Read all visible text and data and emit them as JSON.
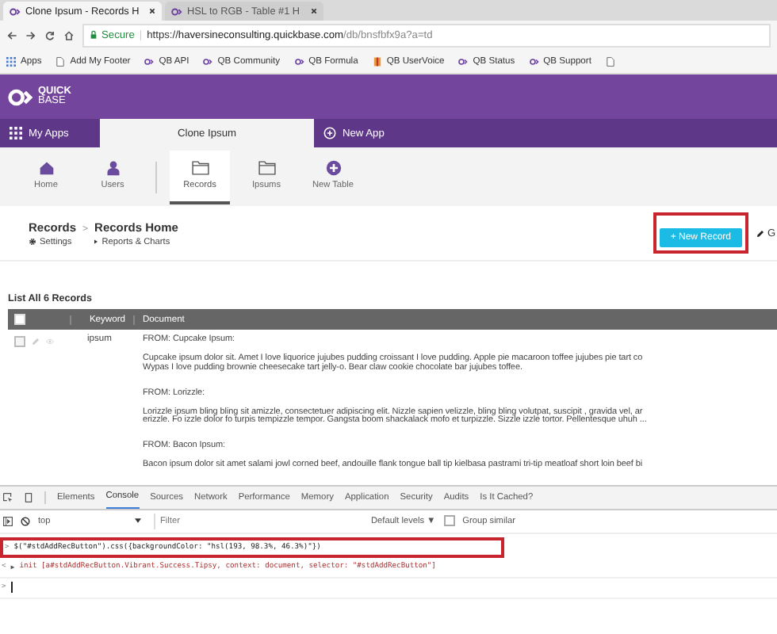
{
  "browser_tabs": [
    {
      "title": "Clone Ipsum - Records H",
      "selected": true
    },
    {
      "title": "HSL to RGB - Table #1 H",
      "selected": false
    }
  ],
  "address_bar": {
    "secure_label": "Secure",
    "divider": "|",
    "url_scheme": "https://",
    "url_host": "haversineconsulting.quickbase.com",
    "url_path": "/db/bnsfbfx9a?a=td"
  },
  "bookmarks": [
    {
      "label": "Apps",
      "kind": "apps"
    },
    {
      "label": "Add My Footer",
      "kind": "page"
    },
    {
      "label": "QB API",
      "kind": "qb"
    },
    {
      "label": "QB Community",
      "kind": "qb"
    },
    {
      "label": "QB Formula",
      "kind": "qb"
    },
    {
      "label": "QB UserVoice",
      "kind": "voice"
    },
    {
      "label": "QB Status",
      "kind": "qb"
    },
    {
      "label": "QB Support",
      "kind": "qb"
    }
  ],
  "logo": {
    "line_1": "QUICK",
    "line_2": "BASE"
  },
  "app_tabs": [
    {
      "label": "My Apps",
      "kind": "apps",
      "selected": false
    },
    {
      "label": "Clone Ipsum",
      "kind": "plain",
      "selected": true
    },
    {
      "label": "New App",
      "kind": "new",
      "selected": false
    }
  ],
  "table_tabs": [
    {
      "label": "Home",
      "kind": "home",
      "selected": false
    },
    {
      "label": "Users",
      "kind": "user",
      "selected": false
    },
    {
      "label": "Records",
      "kind": "folder",
      "selected": true
    },
    {
      "label": "Ipsums",
      "kind": "folder",
      "selected": false
    },
    {
      "label": "New Table",
      "kind": "add",
      "selected": false
    }
  ],
  "breadcrumb": {
    "table": "Records",
    "separator": ">",
    "page": "Records Home",
    "settings": "Settings",
    "reports": "Reports & Charts"
  },
  "new_record_button": "+ New Record",
  "edit_link": "G",
  "report_title": "List All 6 Records",
  "table": {
    "select_all_checked": false,
    "columns": [
      "Keyword",
      "Document"
    ],
    "rows": [
      {
        "checked": false,
        "keyword": "ipsum",
        "blocks": [
          {
            "heading": "FROM: Cupcake Ipsum:",
            "lines": [
              "Cupcake ipsum dolor sit. Amet I love liquorice jujubes pudding croissant I love pudding. Apple pie macaroon toffee jujubes pie tart co",
              "Wypas I love pudding brownie cheesecake tart jelly-o. Bear claw cookie chocolate bar jujubes toffee."
            ]
          },
          {
            "heading": "FROM: Lorizzle:",
            "lines": [
              "Lorizzle ipsum bling bling sit amizzle, consectetuer adipiscing elit. Nizzle sapien velizzle, bling bling volutpat, suscipit , gravida vel, ar",
              "erizzle. Fo izzle dolor fo turpis tempizzle tempor. Gangsta boom shackalack mofo et turpizzle. Sizzle izzle tortor. Pellentesque uhuh ..."
            ]
          },
          {
            "heading": "FROM: Bacon Ipsum:",
            "lines": [
              "Bacon ipsum dolor sit amet salami jowl corned beef, andouille flank tongue ball tip kielbasa pastrami tri-tip meatloaf short loin beef bi"
            ]
          }
        ]
      }
    ]
  },
  "devtools": {
    "tabs": [
      {
        "label": "Elements",
        "selected": false
      },
      {
        "label": "Console",
        "selected": true
      },
      {
        "label": "Sources",
        "selected": false
      },
      {
        "label": "Network",
        "selected": false
      },
      {
        "label": "Performance",
        "selected": false
      },
      {
        "label": "Memory",
        "selected": false
      },
      {
        "label": "Application",
        "selected": false
      },
      {
        "label": "Security",
        "selected": false
      },
      {
        "label": "Audits",
        "selected": false
      },
      {
        "label": "Is It Cached?",
        "selected": false
      }
    ],
    "context": "top",
    "filter_placeholder": "Filter",
    "levels": "Default levels ▼",
    "group_similar": {
      "label": "Group similar",
      "checked": false
    },
    "console": [
      {
        "kind": "input",
        "prompt": ">",
        "text": "$(\"#stdAddRecButton\").css({backgroundColor: \"hsl(193, 98.3%, 46.3%)\"})",
        "highlighted": true
      },
      {
        "kind": "output",
        "prompt": "<",
        "marker": "▶",
        "text": "init [a#stdAddRecButton.Vibrant.Success.Tipsy, context: document, selector: \"#stdAddRecButton\"]",
        "highlighted": false
      },
      {
        "kind": "prompt",
        "prompt": ">",
        "highlighted": false
      }
    ]
  }
}
